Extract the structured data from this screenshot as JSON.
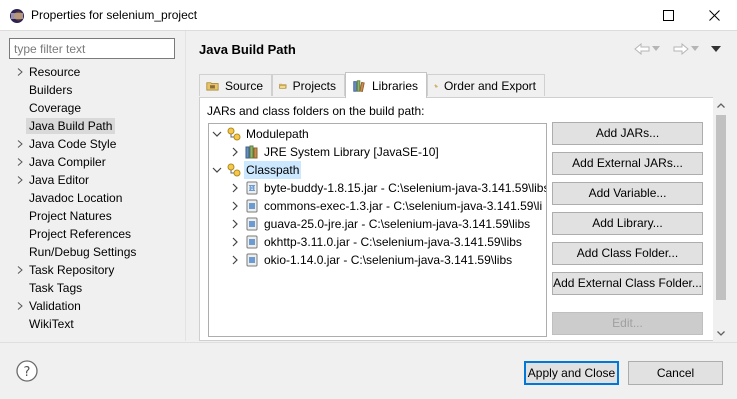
{
  "window": {
    "title": "Properties for selenium_project"
  },
  "filter": {
    "placeholder": "type filter text",
    "value": ""
  },
  "nav": {
    "items": [
      {
        "label": "Resource",
        "expandable": true
      },
      {
        "label": "Builders",
        "expandable": false
      },
      {
        "label": "Coverage",
        "expandable": false
      },
      {
        "label": "Java Build Path",
        "expandable": false,
        "selected": true
      },
      {
        "label": "Java Code Style",
        "expandable": true
      },
      {
        "label": "Java Compiler",
        "expandable": true
      },
      {
        "label": "Java Editor",
        "expandable": true
      },
      {
        "label": "Javadoc Location",
        "expandable": false
      },
      {
        "label": "Project Natures",
        "expandable": false
      },
      {
        "label": "Project References",
        "expandable": false
      },
      {
        "label": "Run/Debug Settings",
        "expandable": false
      },
      {
        "label": "Task Repository",
        "expandable": true
      },
      {
        "label": "Task Tags",
        "expandable": false
      },
      {
        "label": "Validation",
        "expandable": true
      },
      {
        "label": "WikiText",
        "expandable": false
      }
    ]
  },
  "page": {
    "title": "Java Build Path"
  },
  "tabs": [
    {
      "label": "Source",
      "icon": "source-folder-icon"
    },
    {
      "label": "Projects",
      "icon": "projects-icon"
    },
    {
      "label": "Libraries",
      "icon": "libraries-icon",
      "active": true
    },
    {
      "label": "Order and Export",
      "icon": "order-export-icon"
    }
  ],
  "libraries": {
    "caption": "JARs and class folders on the build path:",
    "tree": {
      "modulepath": {
        "label": "Modulepath",
        "children": [
          "JRE System Library [JavaSE-10]"
        ]
      },
      "classpath": {
        "label": "Classpath",
        "children": [
          "byte-buddy-1.8.15.jar - C:\\selenium-java-3.141.59\\libs",
          "commons-exec-1.3.jar - C:\\selenium-java-3.141.59\\li",
          "guava-25.0-jre.jar - C:\\selenium-java-3.141.59\\libs",
          "okhttp-3.11.0.jar - C:\\selenium-java-3.141.59\\libs",
          "okio-1.14.0.jar - C:\\selenium-java-3.141.59\\libs"
        ]
      }
    },
    "buttons": {
      "add_jars": "Add JARs...",
      "add_external_jars": "Add External JARs...",
      "add_variable": "Add Variable...",
      "add_library": "Add Library...",
      "add_class_folder": "Add Class Folder...",
      "add_external_class_folder": "Add External Class Folder...",
      "edit": "Edit..."
    }
  },
  "dialog": {
    "apply_close": "Apply and Close",
    "cancel": "Cancel"
  },
  "colors": {
    "selection": "#cce8ff",
    "default_button_border": "#0078d7",
    "nav_selected": "#d9d9d9"
  }
}
